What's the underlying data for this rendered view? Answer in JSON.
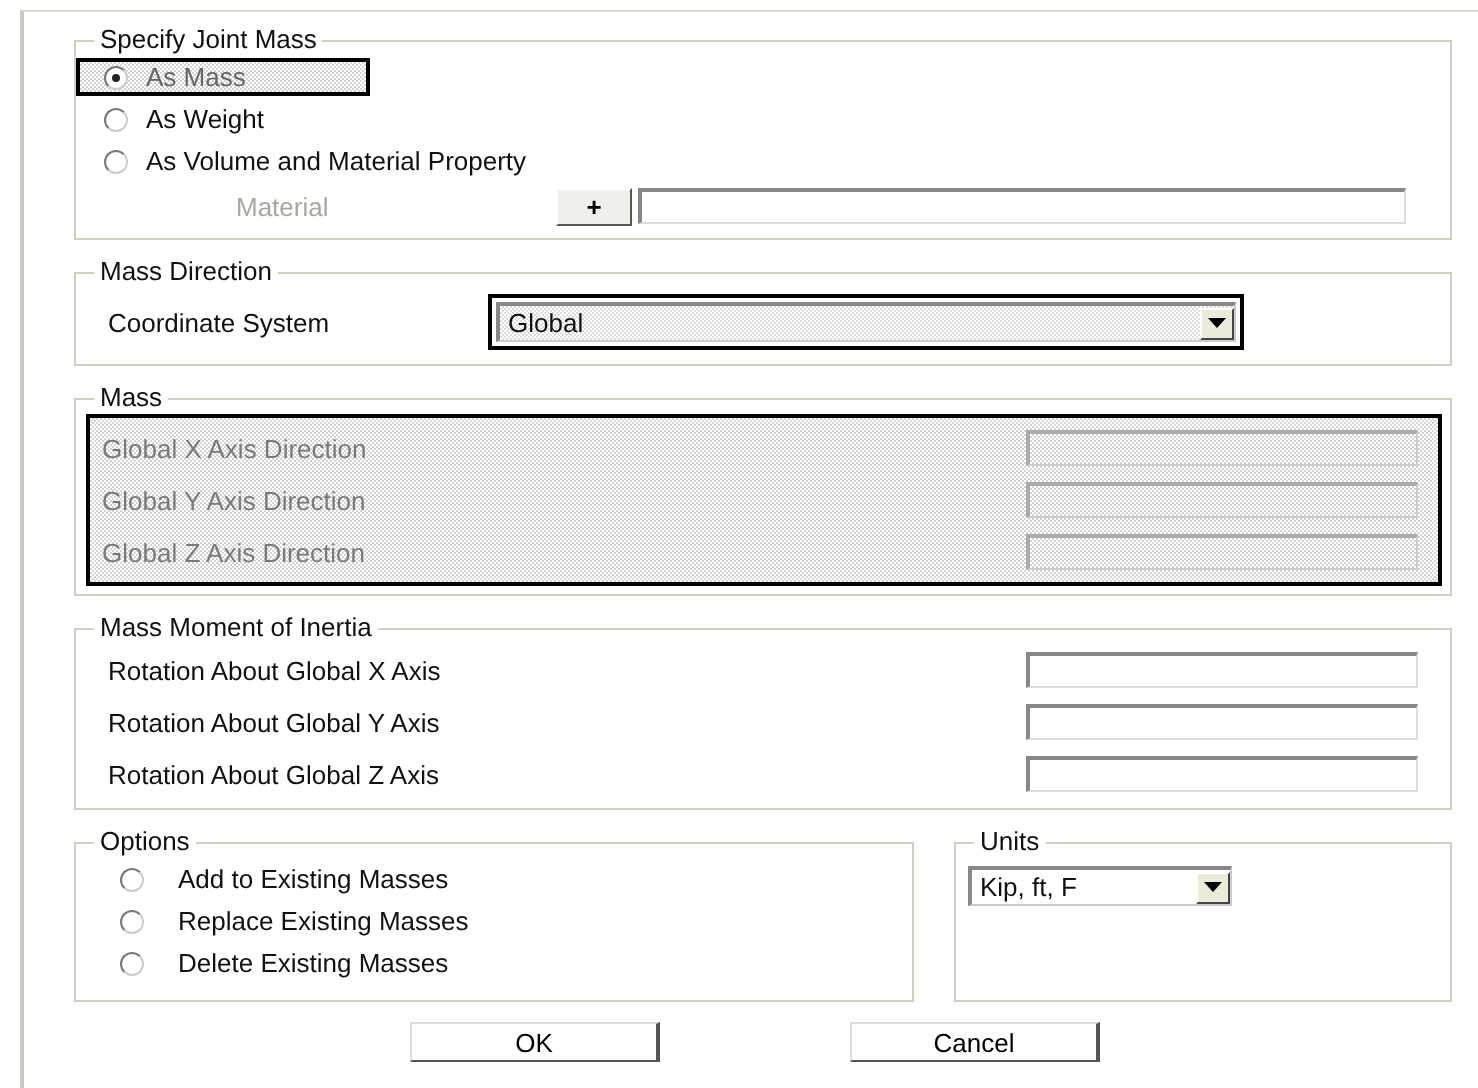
{
  "specify_joint_mass": {
    "title": "Specify Joint Mass",
    "options": [
      {
        "label": "As Mass",
        "selected": true,
        "highlighted": true
      },
      {
        "label": "As Weight",
        "selected": false,
        "highlighted": false
      },
      {
        "label": "As Volume and Material Property",
        "selected": false,
        "highlighted": false
      }
    ],
    "material": {
      "label": "Material",
      "button": "+",
      "disabled": true
    }
  },
  "mass_direction": {
    "title": "Mass Direction",
    "coordinate_system": {
      "label": "Coordinate System",
      "value": "Global",
      "highlighted": true
    }
  },
  "mass": {
    "title": "Mass",
    "disabled": true,
    "highlighted": true,
    "rows": [
      {
        "label": "Global X Axis Direction"
      },
      {
        "label": "Global Y Axis Direction"
      },
      {
        "label": "Global Z Axis Direction"
      }
    ]
  },
  "mass_moment_of_inertia": {
    "title": "Mass Moment of Inertia",
    "rows": [
      {
        "label": "Rotation About Global X Axis"
      },
      {
        "label": "Rotation About Global Y Axis"
      },
      {
        "label": "Rotation About Global Z Axis"
      }
    ]
  },
  "options": {
    "title": "Options",
    "items": [
      {
        "label": "Add to Existing Masses",
        "selected": false
      },
      {
        "label": "Replace Existing Masses",
        "selected": false
      },
      {
        "label": "Delete Existing Masses",
        "selected": false
      }
    ]
  },
  "units": {
    "title": "Units",
    "value": "Kip, ft, F"
  },
  "buttons": [
    {
      "label": "OK"
    },
    {
      "label": "Cancel"
    }
  ]
}
